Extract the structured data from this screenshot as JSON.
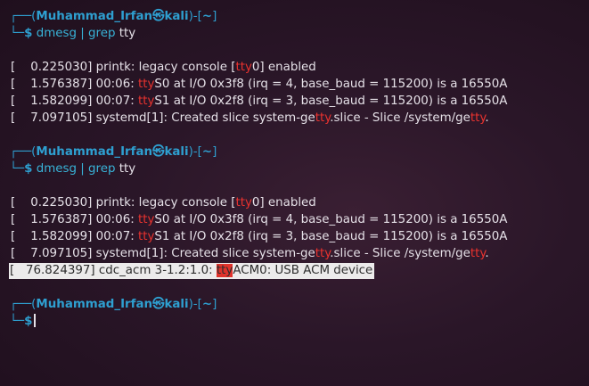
{
  "prompt": {
    "box_top": "┌──(",
    "user": "Muhammad_Irfan",
    "skull": "㉿",
    "host": "kali",
    "close_paren": ")-[",
    "cwd": "~",
    "close_bracket": "]",
    "box_bottom": "└─",
    "dollar": "$"
  },
  "blocks": [
    {
      "command": {
        "cmd": "dmesg",
        "pipe": "|",
        "grep": "grep",
        "arg": "tty"
      },
      "lines": [
        {
          "a": "[    0.225030] printk: legacy console [",
          "h": "tty",
          "b": "0] enabled"
        },
        {
          "a": "[    1.576387] 00:06: ",
          "h": "tty",
          "b": "S0 at I/O 0x3f8 (irq = 4, base_baud = 115200) is a 16550A"
        },
        {
          "a": "[    1.582099] 00:07: ",
          "h": "tty",
          "b": "S1 at I/O 0x2f8 (irq = 3, base_baud = 115200) is a 16550A"
        },
        {
          "a": "[    7.097105] systemd[1]: Created slice system-ge",
          "h": "tty",
          "b": ".slice - Slice /system/ge",
          "h2": "tty",
          "c": "."
        }
      ]
    },
    {
      "command": {
        "cmd": "dmesg",
        "pipe": "|",
        "grep": "grep",
        "arg": "tty"
      },
      "lines": [
        {
          "a": "[    0.225030] printk: legacy console [",
          "h": "tty",
          "b": "0] enabled"
        },
        {
          "a": "[    1.576387] 00:06: ",
          "h": "tty",
          "b": "S0 at I/O 0x3f8 (irq = 4, base_baud = 115200) is a 16550A"
        },
        {
          "a": "[    1.582099] 00:07: ",
          "h": "tty",
          "b": "S1 at I/O 0x2f8 (irq = 3, base_baud = 115200) is a 16550A"
        },
        {
          "a": "[    7.097105] systemd[1]: Created slice system-ge",
          "h": "tty",
          "b": ".slice - Slice /system/ge",
          "h2": "tty",
          "c": "."
        }
      ],
      "new_line": {
        "a": "[   76.824397] cdc_acm 3-1.2:1.0: ",
        "h": "tty",
        "b": "ACM0: USB ACM device"
      }
    }
  ]
}
